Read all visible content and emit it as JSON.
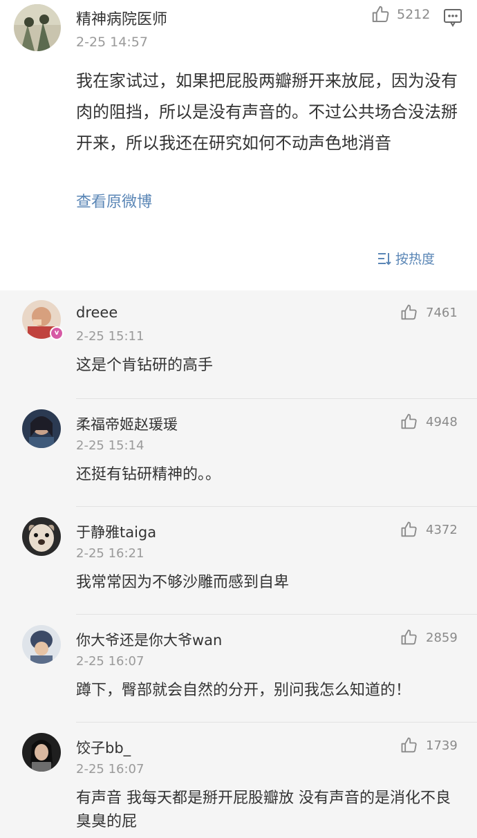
{
  "post": {
    "author": "精神病院医师",
    "time": "2-25 14:57",
    "likes": "5212",
    "content": "我在家试过，如果把屁股两瓣掰开来放屁，因为没有肉的阻挡，所以是没有声音的。不过公共场合没法掰开来，所以我还在研究如何不动声色地消音",
    "view_original": "查看原微博",
    "sort_label": "按热度"
  },
  "comments": [
    {
      "name": "dreee",
      "time": "2-25 15:11",
      "likes": "7461",
      "text": "这是个肯钻研的高手"
    },
    {
      "name": "柔福帝姬赵瑗瑗",
      "time": "2-25 15:14",
      "likes": "4948",
      "text": "还挺有钻研精神的。。"
    },
    {
      "name": "于静雅taiga",
      "time": "2-25 16:21",
      "likes": "4372",
      "text": "我常常因为不够沙雕而感到自卑"
    },
    {
      "name": "你大爷还是你大爷wan",
      "time": "2-25 16:07",
      "likes": "2859",
      "text": "蹲下，臀部就会自然的分开，别问我怎么知道的！"
    },
    {
      "name": "饺子bb_",
      "time": "2-25 16:07",
      "likes": "1739",
      "text": "有声音 我每天都是掰开屁股瓣放 没有声音的是消化不良臭臭的屁"
    }
  ],
  "colors": {
    "link": "#5a86b6",
    "comment_bg": "#f5f5f5",
    "muted": "#9a9a9a",
    "badge": "#d65aa5"
  },
  "icons": {
    "like": "thumbs-up-icon",
    "menu": "comment-box-icon",
    "sort": "sort-icon"
  }
}
